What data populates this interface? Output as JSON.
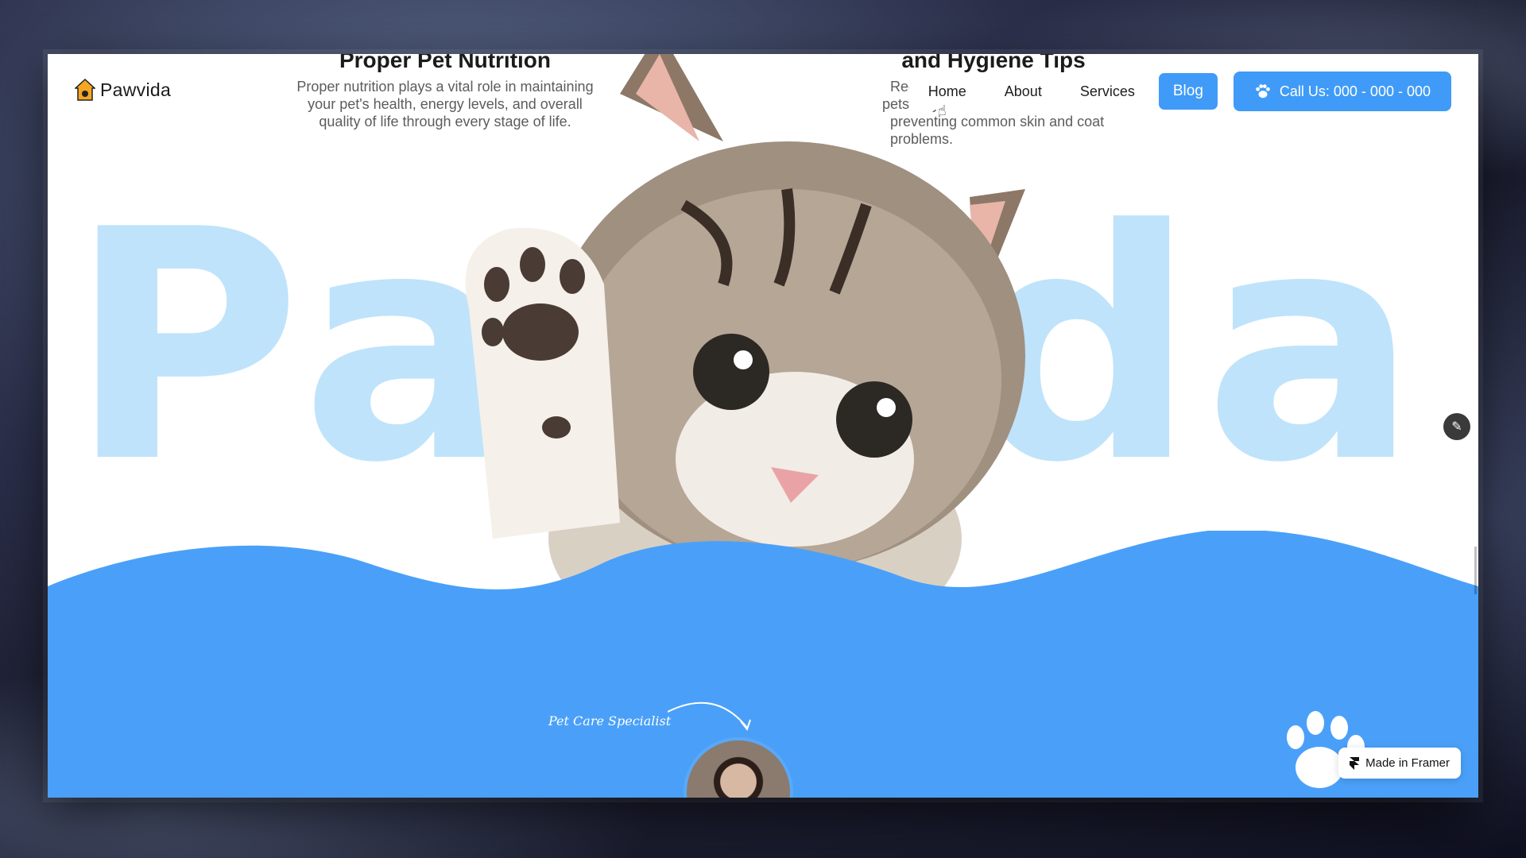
{
  "brand": {
    "name": "Pawvida"
  },
  "articles": [
    {
      "title": "Proper Pet Nutrition",
      "body_lines": [
        "Proper nutrition plays a vital role in maintaining",
        "your pet's health, energy levels, and overall",
        "quality of life through every stage of life."
      ]
    },
    {
      "title": "and Hygiene Tips",
      "body_lines": [
        "Regular g",
        "pets stay c",
        "preventing common skin and coat problems."
      ]
    }
  ],
  "nav": {
    "items": [
      "Home",
      "About",
      "Services"
    ],
    "blog_label": "Blog",
    "call_label": "Call Us: 000 - 000 - 000"
  },
  "hero": {
    "big_word_left": "Pa",
    "big_word_right": "da",
    "specialist_label": "Pet Care Specialist"
  },
  "badge": {
    "label": "Made in Framer"
  },
  "colors": {
    "accent": "#3f9bf7",
    "hero_text": "#bfe3fb",
    "wave": "#4aa0f8"
  },
  "icons": {
    "logo": "house-paw-icon",
    "call": "paw-icon",
    "edit": "pencil-icon",
    "framer": "framer-logo-icon"
  }
}
